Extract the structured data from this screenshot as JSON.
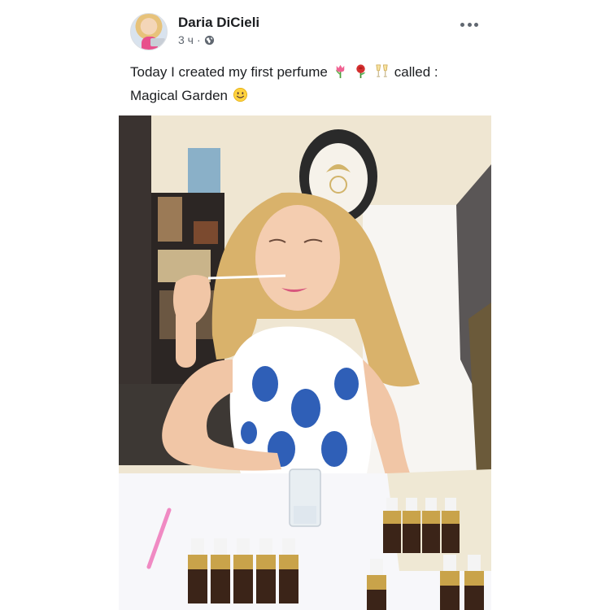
{
  "post": {
    "author": "Daria DiCieli",
    "time": "3 ч",
    "separator": "·",
    "privacy_icon": "globe-icon",
    "more_icon": "more-options-icon",
    "text_before": "Today I created my first perfume",
    "text_after": "called :",
    "text_line2": "Magical Garden",
    "emojis": [
      "tulip-emoji",
      "rose-emoji",
      "champagne-glasses-emoji",
      "smiling-face-emoji"
    ]
  },
  "photo": {
    "subject": "woman-smelling-perfume-test-strip",
    "dress_color": "#2f5fb7",
    "hair_color": "#d9b26b",
    "bottle_cap_color": "#c9a34a"
  }
}
